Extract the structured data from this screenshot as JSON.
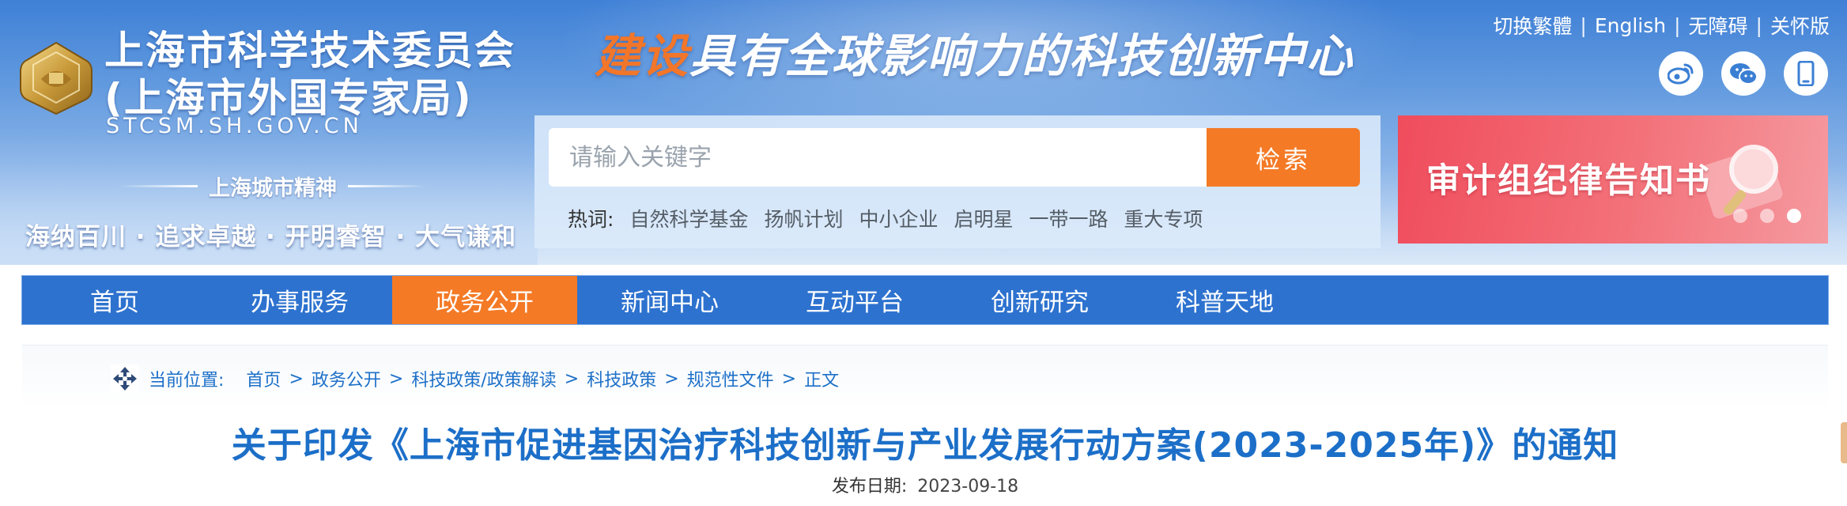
{
  "header": {
    "title_line1": "上海市科学技术委员会",
    "title_line2": "(上海市外国专家局)",
    "domain": "STCSM.SH.GOV.CN",
    "spirit_title": "上海城市精神",
    "spirit_motto": "海纳百川 · 追求卓越 · 开明睿智 · 大气谦和",
    "slogan_accent": "建设",
    "slogan_rest": "具有全球影响力的科技创新中心"
  },
  "top_links": [
    {
      "label": "切换繁體"
    },
    {
      "label": "English"
    },
    {
      "label": "无障碍"
    },
    {
      "label": "关怀版"
    }
  ],
  "social": [
    "weibo-icon",
    "wechat-icon",
    "mobile-icon"
  ],
  "search": {
    "placeholder": "请输入关键字",
    "button_label": "检索",
    "hot_label": "热词:",
    "hot_items": [
      "自然科学基金",
      "扬帆计划",
      "中小企业",
      "启明星",
      "一带一路",
      "重大专项"
    ]
  },
  "banner": {
    "text": "审计组纪律告知书",
    "slide_count": 3,
    "active_slide": 3
  },
  "nav": {
    "items": [
      {
        "label": "首页",
        "active": false
      },
      {
        "label": "办事服务",
        "active": false
      },
      {
        "label": "政务公开",
        "active": true
      },
      {
        "label": "新闻中心",
        "active": false
      },
      {
        "label": "互动平台",
        "active": false
      },
      {
        "label": "创新研究",
        "active": false
      },
      {
        "label": "科普天地",
        "active": false
      }
    ]
  },
  "breadcrumb": {
    "label": "当前位置:",
    "items": [
      "首页",
      "政务公开",
      "科技政策/政策解读",
      "科技政策",
      "规范性文件",
      "正文"
    ]
  },
  "article": {
    "title": "关于印发《上海市促进基因治疗科技创新与产业发展行动方案(2023-2025年)》的通知",
    "publish_label": "发布日期:",
    "publish_date": "2023-09-18"
  },
  "colors": {
    "nav_bg": "#2d72cf",
    "accent_orange": "#f47a26",
    "title_blue": "#1c6fc8",
    "banner_red": "#f04c5c"
  }
}
